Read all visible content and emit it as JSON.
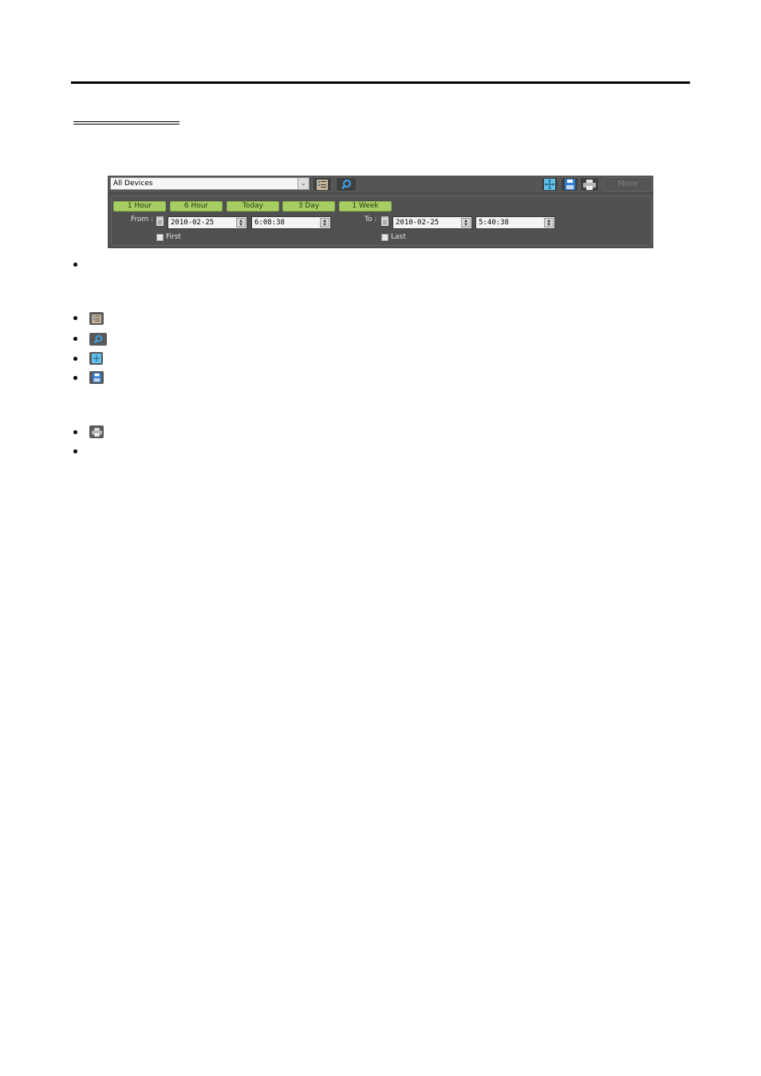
{
  "toolbar": {
    "device_select": {
      "value": "All Devices",
      "arrow_icon": "chevron-down-icon"
    },
    "icons": {
      "filter": "filter-list-icon",
      "search": "search-icon",
      "fit": "fit-screen-icon",
      "save": "save-icon",
      "print": "print-icon"
    },
    "more_label": "More",
    "range_buttons": [
      "1 Hour",
      "6 Hour",
      "Today",
      "3 Day",
      "1 Week"
    ],
    "from": {
      "label": "From :",
      "date": "2010-02-25",
      "time": "6:08:38",
      "checkbox_label": "First",
      "checked": false
    },
    "to": {
      "label": "To :",
      "date": "2010-02-25",
      "time": "5:40:38",
      "checkbox_label": "Last",
      "checked": false
    },
    "colors": {
      "panel": "#505050",
      "range_button": "#a5cd62"
    }
  },
  "bullets": [
    {
      "icon": null
    },
    {
      "icon": "filter-list-icon"
    },
    {
      "icon": "search-icon"
    },
    {
      "icon": "fit-screen-icon"
    },
    {
      "icon": "save-icon"
    },
    {
      "icon": "print-icon"
    },
    {
      "icon": null
    }
  ]
}
